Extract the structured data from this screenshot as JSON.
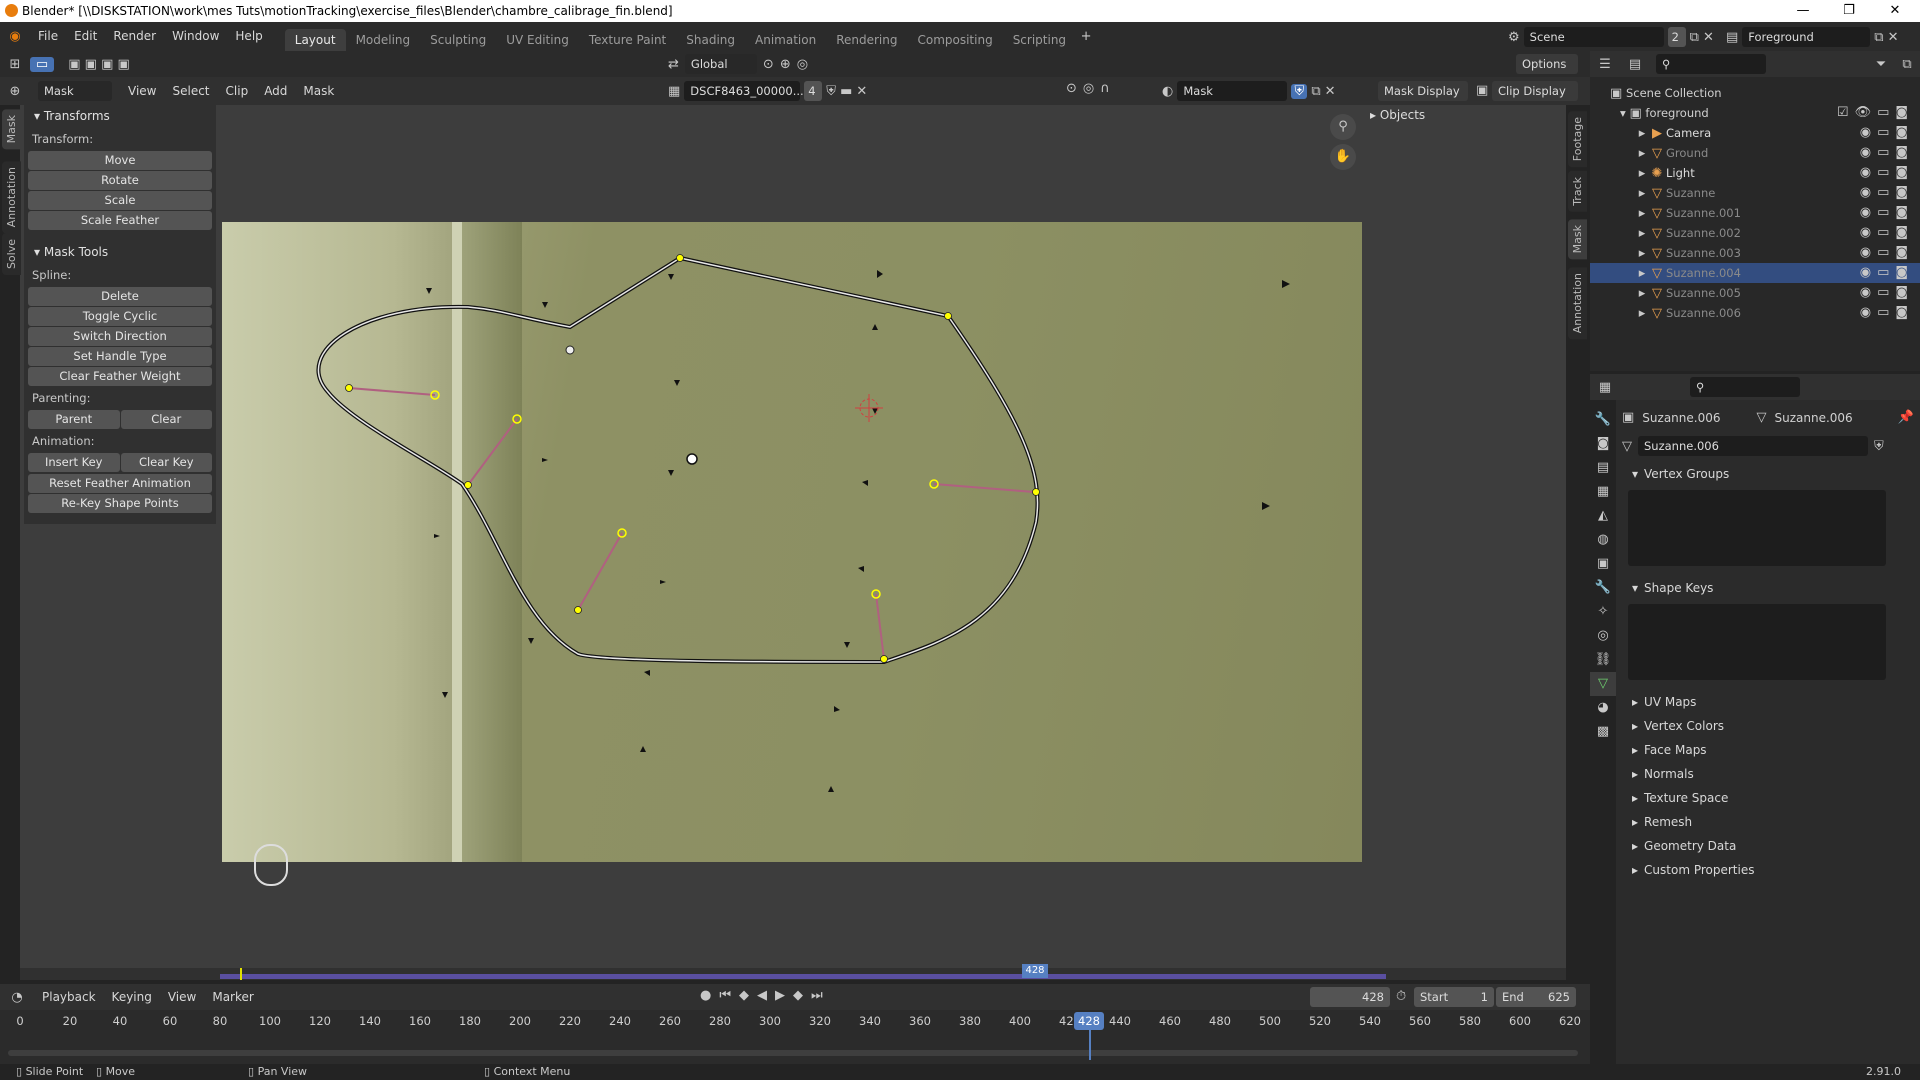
{
  "window": {
    "title": "Blender* [\\\\DISKSTATION\\work\\mes Tuts\\motionTracking\\exercise_files\\Blender\\chambre_calibrage_fin.blend]",
    "min": "—",
    "max": "❐",
    "close": "✕"
  },
  "menus": [
    "File",
    "Edit",
    "Render",
    "Window",
    "Help"
  ],
  "workspaces": [
    "Layout",
    "Modeling",
    "Sculpting",
    "UV Editing",
    "Texture Paint",
    "Shading",
    "Animation",
    "Rendering",
    "Compositing",
    "Scripting"
  ],
  "active_workspace": "Layout",
  "scene": {
    "name": "Scene",
    "users": "2",
    "view_layer": "Foreground"
  },
  "toolbar": {
    "orientation": "Global",
    "options": "Options"
  },
  "clip_header": {
    "mode": "Mask",
    "menus": [
      "View",
      "Select",
      "Clip",
      "Add",
      "Mask"
    ],
    "clip_name": "DSCF8463_00000...",
    "clip_users": "4",
    "mask_name": "Mask",
    "mask_display": "Mask Display",
    "clip_display": "Clip Display"
  },
  "sidebar": {
    "transforms": {
      "title": "Transforms",
      "label": "Transform:",
      "buttons": [
        "Move",
        "Rotate",
        "Scale",
        "Scale Feather"
      ]
    },
    "mask_tools": {
      "title": "Mask Tools",
      "spline_label": "Spline:",
      "spline_buttons": [
        "Delete",
        "Toggle Cyclic",
        "Switch Direction",
        "Set Handle Type",
        "Clear Feather Weight"
      ],
      "parenting_label": "Parenting:",
      "parent": "Parent",
      "clear": "Clear",
      "animation_label": "Animation:",
      "insert_key": "Insert Key",
      "clear_key": "Clear Key",
      "reset_feather": "Reset Feather Animation",
      "rekey": "Re-Key Shape Points"
    }
  },
  "left_tabs": [
    "Mask",
    "Annotation",
    "Solve"
  ],
  "right_tabs": [
    "Footage",
    "Track",
    "Mask",
    "Annotation"
  ],
  "objects_panel": "Objects",
  "outliner": {
    "root": "Scene Collection",
    "collection": "foreground",
    "items": [
      {
        "name": "Camera",
        "dim": false,
        "selected": false
      },
      {
        "name": "Ground",
        "dim": true,
        "selected": false
      },
      {
        "name": "Light",
        "dim": false,
        "selected": false
      },
      {
        "name": "Suzanne",
        "dim": true,
        "selected": false
      },
      {
        "name": "Suzanne.001",
        "dim": true,
        "selected": false
      },
      {
        "name": "Suzanne.002",
        "dim": true,
        "selected": false
      },
      {
        "name": "Suzanne.003",
        "dim": true,
        "selected": false
      },
      {
        "name": "Suzanne.004",
        "dim": true,
        "selected": true
      },
      {
        "name": "Suzanne.005",
        "dim": true,
        "selected": false
      },
      {
        "name": "Suzanne.006",
        "dim": true,
        "selected": false
      }
    ]
  },
  "properties": {
    "object": "Suzanne.006",
    "mesh": "Suzanne.006",
    "datablock": "Suzanne.006",
    "panels": [
      "Vertex Groups",
      "Shape Keys",
      "UV Maps",
      "Vertex Colors",
      "Face Maps",
      "Normals",
      "Texture Space",
      "Remesh",
      "Geometry Data",
      "Custom Properties"
    ]
  },
  "timeline": {
    "menus": [
      "Playback",
      "Keying",
      "View",
      "Marker"
    ],
    "current_frame": "428",
    "start_label": "Start",
    "start": "1",
    "end_label": "End",
    "end": "625",
    "ticks": [
      "0",
      "20",
      "40",
      "60",
      "80",
      "100",
      "120",
      "140",
      "160",
      "180",
      "200",
      "220",
      "240",
      "260",
      "280",
      "300",
      "320",
      "340",
      "360",
      "380",
      "400",
      "420",
      "440",
      "460",
      "480",
      "500",
      "520",
      "540",
      "560",
      "580",
      "600",
      "620"
    ],
    "scrub_marker": "428"
  },
  "statusbar": {
    "items": [
      "Slide Point",
      "Move",
      "Pan View",
      "Context Menu"
    ],
    "version": "2.91.0"
  },
  "colors": {
    "accent": "#4772b3",
    "point": "#ffff00",
    "feather": "#b06080",
    "bg": "#2b2b2b"
  }
}
